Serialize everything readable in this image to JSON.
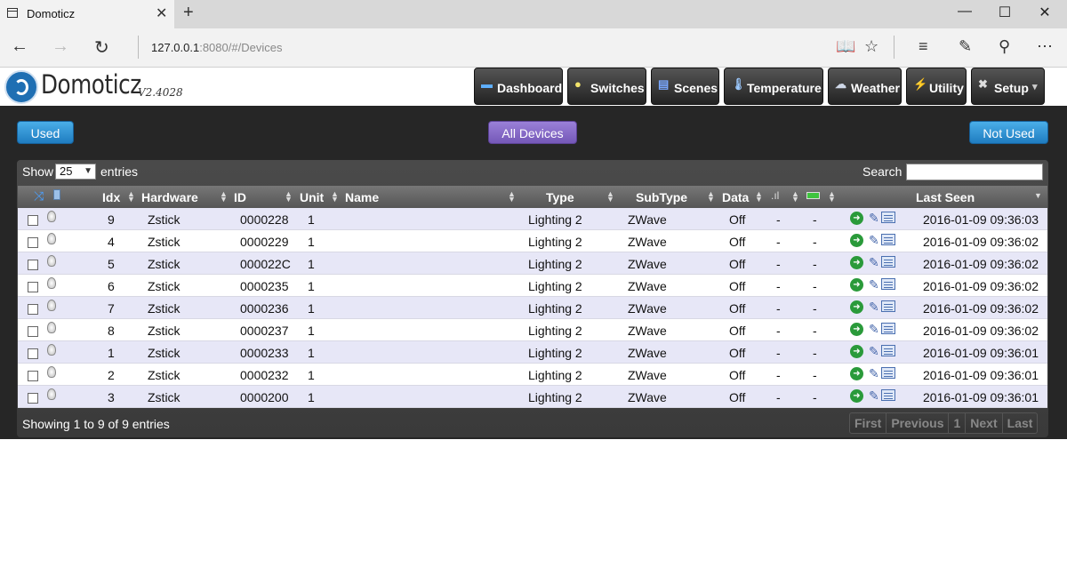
{
  "browser": {
    "tab_title": "Domoticz",
    "tab_close": "✕",
    "new_tab": "+",
    "url_host": "127.0.0.1",
    "url_rest": ":8080/#/Devices",
    "window": {
      "minimize": "—",
      "maximize": "☐",
      "close": "✕"
    },
    "nav": {
      "back": "←",
      "forward": "→",
      "refresh": "↻"
    },
    "tools": {
      "reading": "📖",
      "favorite": "☆",
      "hub": "≡",
      "notes": "✎",
      "share": "⚲",
      "more": "⋯"
    }
  },
  "app": {
    "logo": "Domoticz",
    "version": "V2.4028",
    "menu": [
      {
        "label": "Dashboard",
        "icon": "dashboard-icon",
        "glyph": "▬"
      },
      {
        "label": "Switches",
        "icon": "bulb-icon",
        "glyph": "●"
      },
      {
        "label": "Scenes",
        "icon": "scene-icon",
        "glyph": "▤"
      },
      {
        "label": "Temperature",
        "icon": "thermometer-icon",
        "glyph": "🌡"
      },
      {
        "label": "Weather",
        "icon": "weather-icon",
        "glyph": "☁"
      },
      {
        "label": "Utility",
        "icon": "utility-icon",
        "glyph": "⚡"
      },
      {
        "label": "Setup",
        "icon": "setup-icon",
        "glyph": "✖",
        "caret": "▾"
      }
    ]
  },
  "filters": {
    "used": "Used",
    "all": "All Devices",
    "not_used": "Not Used"
  },
  "table_controls": {
    "show": "Show",
    "page_size": "25",
    "entries": "entries",
    "search": "Search :"
  },
  "columns": {
    "idx": "Idx",
    "hardware": "Hardware",
    "id": "ID",
    "unit": "Unit",
    "name": "Name",
    "type": "Type",
    "subtype": "SubType",
    "data": "Data",
    "last_seen": "Last Seen"
  },
  "rows": [
    {
      "idx": "9",
      "hardware": "Zstick",
      "id": "0000228",
      "unit": "1",
      "name": "",
      "type": "Lighting 2",
      "subtype": "ZWave",
      "data": "Off",
      "signal": "-",
      "battery": "-",
      "last_seen": "2016-01-09 09:36:03"
    },
    {
      "idx": "4",
      "hardware": "Zstick",
      "id": "0000229",
      "unit": "1",
      "name": "",
      "type": "Lighting 2",
      "subtype": "ZWave",
      "data": "Off",
      "signal": "-",
      "battery": "-",
      "last_seen": "2016-01-09 09:36:02"
    },
    {
      "idx": "5",
      "hardware": "Zstick",
      "id": "000022C",
      "unit": "1",
      "name": "",
      "type": "Lighting 2",
      "subtype": "ZWave",
      "data": "Off",
      "signal": "-",
      "battery": "-",
      "last_seen": "2016-01-09 09:36:02"
    },
    {
      "idx": "6",
      "hardware": "Zstick",
      "id": "0000235",
      "unit": "1",
      "name": "",
      "type": "Lighting 2",
      "subtype": "ZWave",
      "data": "Off",
      "signal": "-",
      "battery": "-",
      "last_seen": "2016-01-09 09:36:02"
    },
    {
      "idx": "7",
      "hardware": "Zstick",
      "id": "0000236",
      "unit": "1",
      "name": "",
      "type": "Lighting 2",
      "subtype": "ZWave",
      "data": "Off",
      "signal": "-",
      "battery": "-",
      "last_seen": "2016-01-09 09:36:02"
    },
    {
      "idx": "8",
      "hardware": "Zstick",
      "id": "0000237",
      "unit": "1",
      "name": "",
      "type": "Lighting 2",
      "subtype": "ZWave",
      "data": "Off",
      "signal": "-",
      "battery": "-",
      "last_seen": "2016-01-09 09:36:02"
    },
    {
      "idx": "1",
      "hardware": "Zstick",
      "id": "0000233",
      "unit": "1",
      "name": "",
      "type": "Lighting 2",
      "subtype": "ZWave",
      "data": "Off",
      "signal": "-",
      "battery": "-",
      "last_seen": "2016-01-09 09:36:01"
    },
    {
      "idx": "2",
      "hardware": "Zstick",
      "id": "0000232",
      "unit": "1",
      "name": "",
      "type": "Lighting 2",
      "subtype": "ZWave",
      "data": "Off",
      "signal": "-",
      "battery": "-",
      "last_seen": "2016-01-09 09:36:01"
    },
    {
      "idx": "3",
      "hardware": "Zstick",
      "id": "0000200",
      "unit": "1",
      "name": "",
      "type": "Lighting 2",
      "subtype": "ZWave",
      "data": "Off",
      "signal": "-",
      "battery": "-",
      "last_seen": "2016-01-09 09:36:01"
    }
  ],
  "footer": {
    "info": "Showing 1 to 9 of 9 entries",
    "pager": {
      "first": "First",
      "previous": "Previous",
      "page": "1",
      "next": "Next",
      "last": "Last"
    }
  },
  "colors": {
    "accent_blue": "#1f7cc0",
    "accent_purple": "#7558b8",
    "dark_bg": "#262626"
  }
}
